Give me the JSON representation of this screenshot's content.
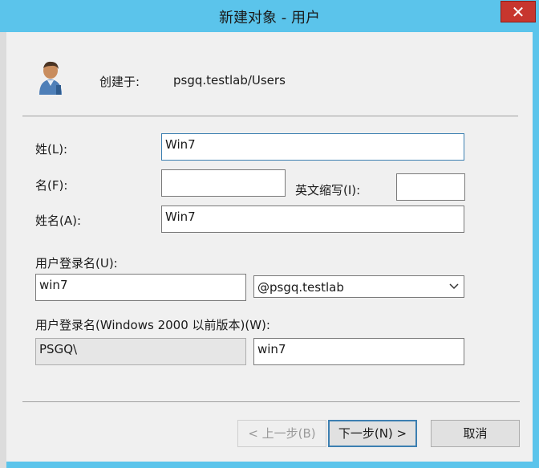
{
  "window": {
    "title": "新建对象 - 用户",
    "close_glyph": "✕"
  },
  "header": {
    "created_in_label": "创建于:",
    "created_in_path": "psgq.testlab/Users",
    "icon": "user-icon"
  },
  "fields": {
    "last_name_label": "姓(L):",
    "last_name_value": "Win7",
    "first_name_label": "名(F):",
    "first_name_value": "",
    "initials_label": "英文缩写(I):",
    "initials_value": "",
    "full_name_label": "姓名(A):",
    "full_name_value": "Win7",
    "logon_name_label": "用户登录名(U):",
    "logon_name_value": "win7",
    "domain_selected": "@psgq.testlab",
    "pre2000_label": "用户登录名(Windows 2000 以前版本)(W):",
    "pre2000_domain": "PSGQ\\",
    "pre2000_name": "win7"
  },
  "buttons": {
    "back": "< 上一步(B)",
    "next": "下一步(N) >",
    "cancel": "取消"
  },
  "colors": {
    "titlebar": "#5bc4eb",
    "close": "#c7362e",
    "dialog_bg": "#f0f0f0",
    "focus_border": "#3c7fb1"
  }
}
